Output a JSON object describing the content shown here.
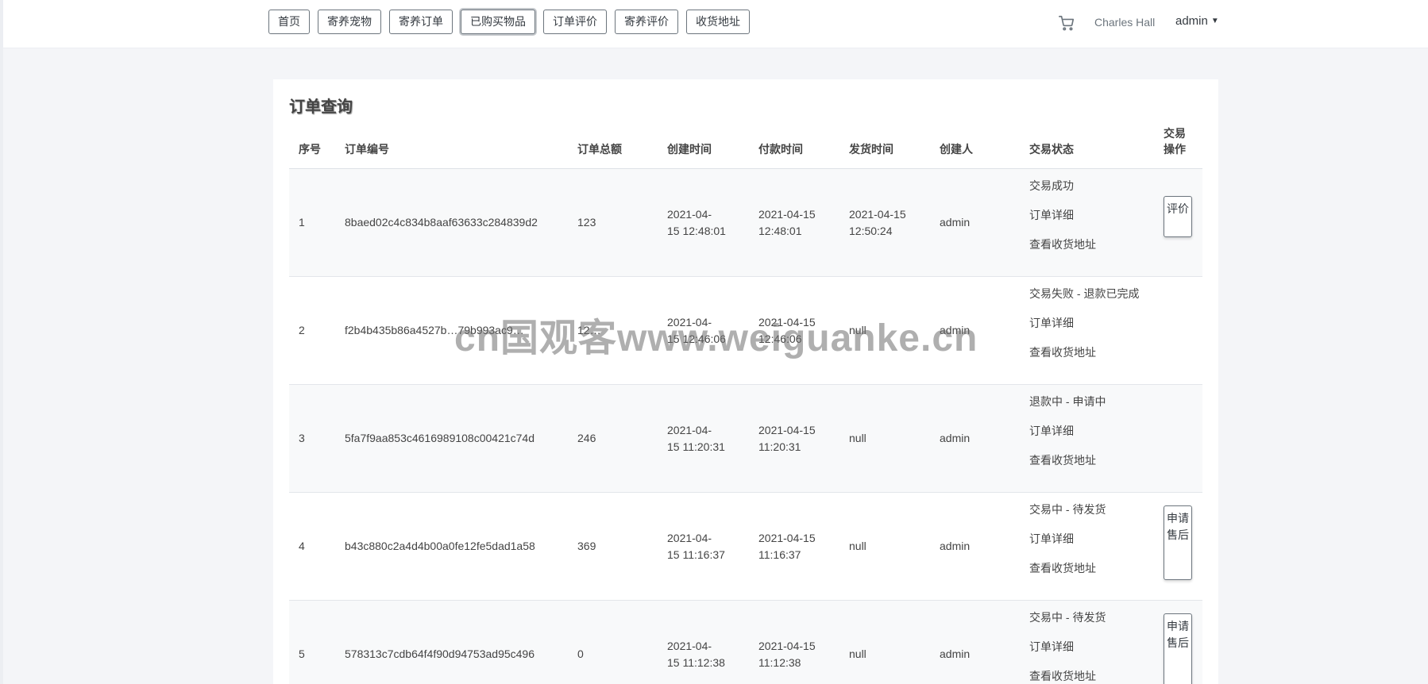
{
  "nav": {
    "items": [
      "首页",
      "寄养宠物",
      "寄养订单",
      "已购买物品",
      "订单评价",
      "寄养评价",
      "收货地址"
    ],
    "active_index": 3
  },
  "header": {
    "avatar_alt": "Charles Hall",
    "user_name": "admin",
    "icons": [
      "cart-icon",
      "chevron-down-icon"
    ]
  },
  "page": {
    "title": "订单查询"
  },
  "table": {
    "headers": [
      "序号",
      "订单编号",
      "订单总额",
      "创建时间",
      "付款时间",
      "发货时间",
      "创建人",
      "交易状态",
      "交易操作"
    ],
    "rows": [
      {
        "no": "1",
        "order_id": "8baed02c4c834b8aaf63633c284839d2",
        "total": "123",
        "created": [
          "2021-04-",
          "15 12:48:01"
        ],
        "paid": [
          "2021-04-15",
          "12:48:01"
        ],
        "shipped": [
          "2021-04-15",
          "12:50:24"
        ],
        "creator": "admin",
        "status": "交易成功",
        "detail": "订单详细",
        "address": "查看收货地址",
        "action": "评价"
      },
      {
        "no": "2",
        "order_id": "f2b4b435b86a4527b…79b993ac9…",
        "total": "12…",
        "created": [
          "2021-04-",
          "15 12:46:06"
        ],
        "paid": [
          "2021-04-15",
          "12:46:06"
        ],
        "shipped": [
          "null",
          ""
        ],
        "creator": "admin",
        "status": "交易失败 - 退款已完成",
        "detail": "订单详细",
        "address": "查看收货地址",
        "action": ""
      },
      {
        "no": "3",
        "order_id": "5fa7f9aa853c4616989108c00421c74d",
        "total": "246",
        "created": [
          "2021-04-",
          "15 11:20:31"
        ],
        "paid": [
          "2021-04-15",
          "11:20:31"
        ],
        "shipped": [
          "null",
          ""
        ],
        "creator": "admin",
        "status": "退款中 - 申请中",
        "detail": "订单详细",
        "address": "查看收货地址",
        "action": ""
      },
      {
        "no": "4",
        "order_id": "b43c880c2a4d4b00a0fe12fe5dad1a58",
        "total": "369",
        "created": [
          "2021-04-",
          "15 11:16:37"
        ],
        "paid": [
          "2021-04-15",
          "11:16:37"
        ],
        "shipped": [
          "null",
          ""
        ],
        "creator": "admin",
        "status": "交易中 - 待发货",
        "detail": "订单详细",
        "address": "查看收货地址",
        "action": "申请售后"
      },
      {
        "no": "5",
        "order_id": "578313c7cdb64f4f90d94753ad95c496",
        "total": "0",
        "created": [
          "2021-04-",
          "15 11:12:38"
        ],
        "paid": [
          "2021-04-15",
          "11:12:38"
        ],
        "shipped": [
          "null",
          ""
        ],
        "creator": "admin",
        "status": "交易中 - 待发货",
        "detail": "订单详细",
        "address": "查看收货地址",
        "action": "申请售后"
      }
    ]
  },
  "watermark": "cn国观客www.weiguanke.cn"
}
